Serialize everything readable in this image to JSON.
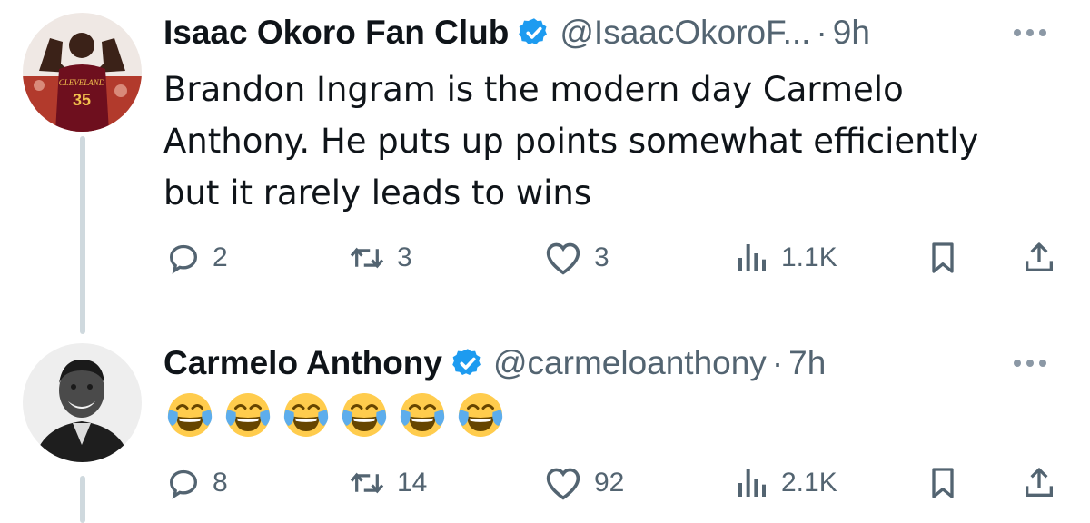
{
  "tweets": [
    {
      "author_name": "Isaac Okoro Fan Club",
      "handle": "@IsaacOkoroF...",
      "separator": "·",
      "time": "9h",
      "text": "Brandon Ingram is the modern day Carmelo Anthony. He puts up points somewhat efficiently but it rarely leads to wins",
      "text_lines": [
        "Brandon Ingram is the modern day Carmelo",
        "Anthony. He puts up points somewhat efficiently",
        "but it rarely leads to wins"
      ],
      "avatar_jersey_text": "35",
      "avatar_jersey_word": "CLEVELAND",
      "replies": "2",
      "reposts": "3",
      "likes": "3",
      "views": "1.1K"
    },
    {
      "author_name": "Carmelo Anthony",
      "handle": "@carmeloanthony",
      "separator": "·",
      "time": "7h",
      "emojis": [
        "😂",
        "😂",
        "😂",
        "😂",
        "😂",
        "😂"
      ],
      "replies": "8",
      "reposts": "14",
      "likes": "92",
      "views": "2.1K"
    }
  ],
  "icons": {
    "verified": "verified-badge-icon",
    "reply": "reply-icon",
    "repost": "repost-icon",
    "like": "like-icon",
    "views": "views-icon",
    "bookmark": "bookmark-icon",
    "share": "share-icon",
    "more": "more-icon"
  },
  "colors": {
    "verified_blue": "#1d9bf0",
    "secondary_text": "#536471",
    "primary_text": "#0f1419",
    "thread_line": "#cfd9de"
  }
}
